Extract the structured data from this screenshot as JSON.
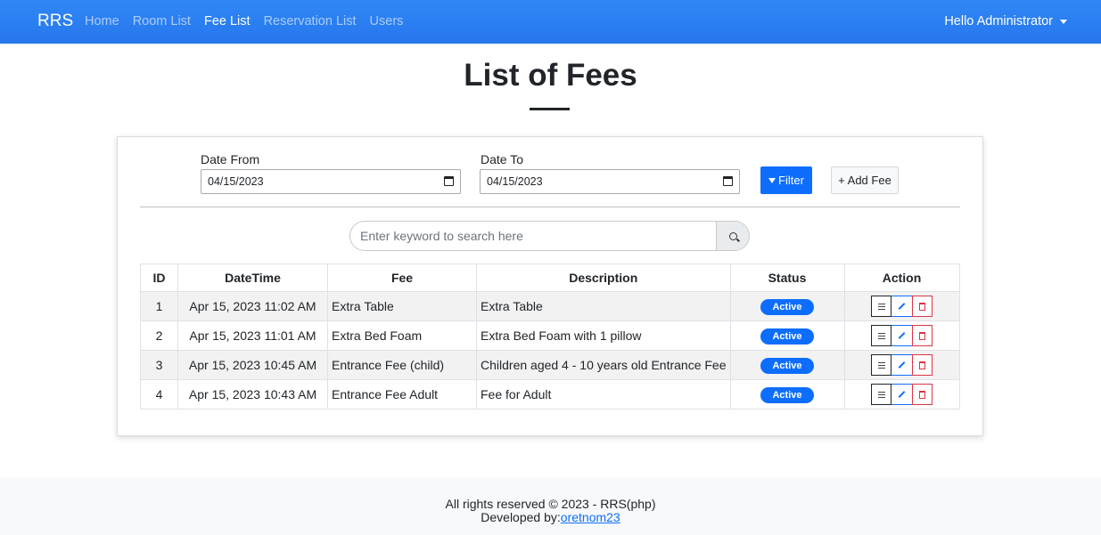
{
  "navbar": {
    "brand": "RRS",
    "links": [
      "Home",
      "Room List",
      "Fee List",
      "Reservation List",
      "Users"
    ],
    "active": "Fee List",
    "user_menu": "Hello Administrator"
  },
  "page": {
    "title": "List of Fees"
  },
  "filters": {
    "date_from_label": "Date From",
    "date_from_value": "04/15/2023",
    "date_to_label": "Date To",
    "date_to_value": "04/15/2023",
    "filter_button": "Filter",
    "add_button": "+ Add Fee"
  },
  "search": {
    "placeholder": "Enter keyword to search here"
  },
  "table": {
    "headers": [
      "ID",
      "DateTime",
      "Fee",
      "Description",
      "Status",
      "Action"
    ],
    "rows": [
      {
        "id": "1",
        "datetime": "Apr 15, 2023 11:02 AM",
        "fee": "Extra Table",
        "description": "Extra Table",
        "status": "Active"
      },
      {
        "id": "2",
        "datetime": "Apr 15, 2023 11:01 AM",
        "fee": "Extra Bed Foam",
        "description": "Extra Bed Foam with 1 pillow",
        "status": "Active"
      },
      {
        "id": "3",
        "datetime": "Apr 15, 2023 10:45 AM",
        "fee": "Entrance Fee (child)",
        "description": "Children aged 4 - 10 years old Entrance Fee",
        "status": "Active"
      },
      {
        "id": "4",
        "datetime": "Apr 15, 2023 10:43 AM",
        "fee": "Entrance Fee Adult",
        "description": "Fee for Adult",
        "status": "Active"
      }
    ]
  },
  "footer": {
    "copyright": "All rights reserved © 2023 - RRS(php)",
    "developed_by_label": "Developed by:",
    "developer": "oretnom23"
  },
  "colors": {
    "navbar": "#2a7ff0",
    "primary": "#0d6efd",
    "danger": "#dc3545"
  }
}
